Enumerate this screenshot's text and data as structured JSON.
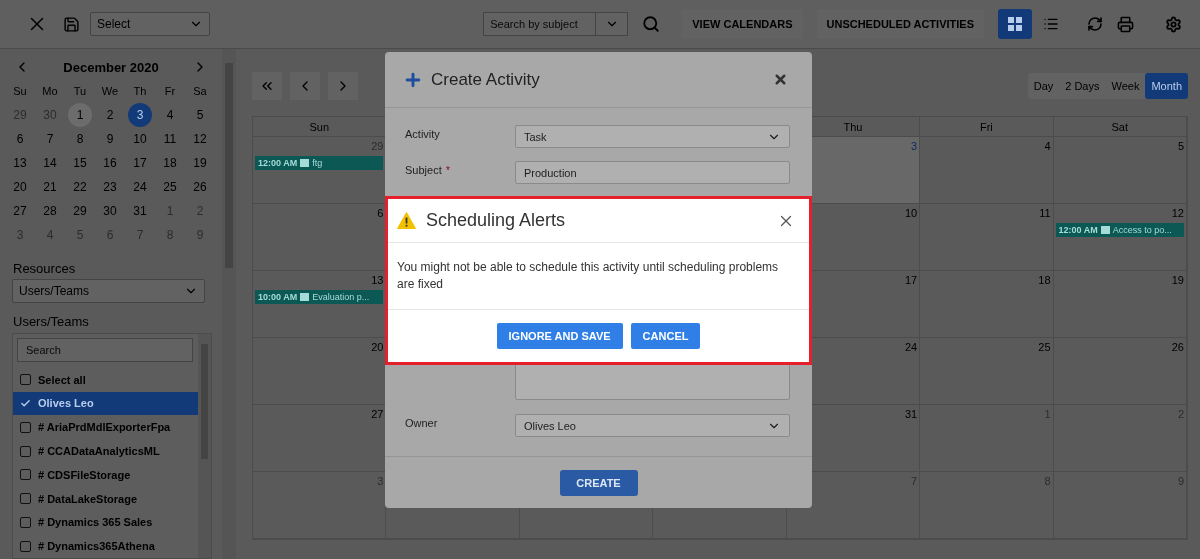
{
  "toolbar": {
    "view_select": {
      "value": "Select"
    },
    "search": {
      "placeholder": "Search by subject"
    },
    "buttons": [
      "VIEW CALENDARS",
      "UNSCHEDULED ACTIVITIES"
    ],
    "view_toggles": [
      {
        "kind": "grid",
        "selected": true
      },
      {
        "kind": "list",
        "selected": false
      }
    ]
  },
  "sidebar": {
    "mini_calendar": {
      "title": "December 2020",
      "weekdays": [
        "Su",
        "Mo",
        "Tu",
        "We",
        "Th",
        "Fr",
        "Sa"
      ],
      "weeks": [
        [
          {
            "label": "29",
            "kind": "muted"
          },
          {
            "label": "30",
            "kind": "muted"
          },
          {
            "label": "1",
            "kind": "hover"
          },
          {
            "label": "2",
            "kind": "normal"
          },
          {
            "label": "3",
            "kind": "today"
          },
          {
            "label": "4",
            "kind": "normal"
          },
          {
            "label": "5",
            "kind": "normal"
          }
        ],
        [
          {
            "label": "6",
            "kind": "normal"
          },
          {
            "label": "7",
            "kind": "normal"
          },
          {
            "label": "8",
            "kind": "normal"
          },
          {
            "label": "9",
            "kind": "normal"
          },
          {
            "label": "10",
            "kind": "normal"
          },
          {
            "label": "11",
            "kind": "normal"
          },
          {
            "label": "12",
            "kind": "normal"
          }
        ],
        [
          {
            "label": "13",
            "kind": "normal"
          },
          {
            "label": "14",
            "kind": "normal"
          },
          {
            "label": "15",
            "kind": "normal"
          },
          {
            "label": "16",
            "kind": "normal"
          },
          {
            "label": "17",
            "kind": "normal"
          },
          {
            "label": "18",
            "kind": "normal"
          },
          {
            "label": "19",
            "kind": "normal"
          }
        ],
        [
          {
            "label": "20",
            "kind": "normal"
          },
          {
            "label": "21",
            "kind": "normal"
          },
          {
            "label": "22",
            "kind": "normal"
          },
          {
            "label": "23",
            "kind": "normal"
          },
          {
            "label": "24",
            "kind": "normal"
          },
          {
            "label": "25",
            "kind": "normal"
          },
          {
            "label": "26",
            "kind": "normal"
          }
        ],
        [
          {
            "label": "27",
            "kind": "normal"
          },
          {
            "label": "28",
            "kind": "normal"
          },
          {
            "label": "29",
            "kind": "normal"
          },
          {
            "label": "30",
            "kind": "normal"
          },
          {
            "label": "31",
            "kind": "normal"
          },
          {
            "label": "1",
            "kind": "muted"
          },
          {
            "label": "2",
            "kind": "muted"
          }
        ],
        [
          {
            "label": "3",
            "kind": "muted"
          },
          {
            "label": "4",
            "kind": "muted"
          },
          {
            "label": "5",
            "kind": "muted"
          },
          {
            "label": "6",
            "kind": "muted"
          },
          {
            "label": "7",
            "kind": "muted"
          },
          {
            "label": "8",
            "kind": "muted"
          },
          {
            "label": "9",
            "kind": "muted"
          }
        ]
      ]
    },
    "resources": {
      "label": "Resources",
      "value": "Users/Teams"
    },
    "users_teams": {
      "label": "Users/Teams",
      "search": {
        "placeholder": "Search"
      },
      "items": [
        {
          "label": "Select all",
          "checked": false,
          "selected": false
        },
        {
          "label": "Olives Leo",
          "checked": true,
          "selected": true
        },
        {
          "label": "# AriaPrdMdlExporterFpa",
          "checked": false,
          "selected": false
        },
        {
          "label": "# CCADataAnalyticsML",
          "checked": false,
          "selected": false
        },
        {
          "label": "# CDSFileStorage",
          "checked": false,
          "selected": false
        },
        {
          "label": "# DataLakeStorage",
          "checked": false,
          "selected": false
        },
        {
          "label": "# Dynamics 365 Sales",
          "checked": false,
          "selected": false
        },
        {
          "label": "# Dynamics365Athena",
          "checked": false,
          "selected": false
        }
      ]
    }
  },
  "calendar": {
    "views": [
      {
        "label": "Day",
        "selected": false
      },
      {
        "label": "2 Days",
        "selected": false
      },
      {
        "label": "Week",
        "selected": false
      },
      {
        "label": "Month",
        "selected": true
      }
    ],
    "columns": [
      "Sun",
      "Thu",
      "Fri",
      "Sat"
    ],
    "weeks": [
      [
        {
          "date": "29",
          "kind": "muted",
          "events": [
            {
              "time": "12:00 AM",
              "title": "ftg"
            }
          ]
        },
        {
          "date": "3",
          "kind": "today"
        },
        {
          "date": "4",
          "kind": "normal"
        },
        {
          "date": "5",
          "kind": "normal"
        }
      ],
      [
        {
          "date": "6",
          "kind": "normal"
        },
        {
          "date": "10",
          "kind": "normal"
        },
        {
          "date": "11",
          "kind": "normal"
        },
        {
          "date": "12",
          "kind": "normal",
          "events": [
            {
              "time": "12:00 AM",
              "title": "Access to po..."
            }
          ]
        }
      ],
      [
        {
          "date": "13",
          "kind": "normal",
          "events": [
            {
              "time": "10:00 AM",
              "title": "Evaluation p..."
            }
          ]
        },
        {
          "date": "17",
          "kind": "normal"
        },
        {
          "date": "18",
          "kind": "normal"
        },
        {
          "date": "19",
          "kind": "normal"
        }
      ],
      [
        {
          "date": "20",
          "kind": "normal"
        },
        {
          "date": "24",
          "kind": "normal"
        },
        {
          "date": "25",
          "kind": "normal"
        },
        {
          "date": "26",
          "kind": "normal"
        }
      ],
      [
        {
          "date": "27",
          "kind": "normal"
        },
        {
          "date": "31",
          "kind": "normal"
        },
        {
          "date": "1",
          "kind": "muted"
        },
        {
          "date": "2",
          "kind": "muted"
        }
      ],
      [
        {
          "date": "3",
          "kind": "muted"
        },
        {
          "date": "7",
          "kind": "muted"
        },
        {
          "date": "8",
          "kind": "muted"
        },
        {
          "date": "9",
          "kind": "muted"
        }
      ]
    ]
  },
  "create_activity": {
    "title": "Create Activity",
    "fields": [
      {
        "kind": "select",
        "label": "Activity",
        "value": "Task"
      },
      {
        "kind": "text",
        "label": "Subject",
        "required_mark": "*",
        "value": "Production"
      },
      {
        "kind": "textarea"
      },
      {
        "kind": "select",
        "label": "Owner",
        "value": "Olives Leo"
      }
    ],
    "submit": "CREATE"
  },
  "alert": {
    "title": "Scheduling Alerts",
    "message": "You might not be able to schedule this activity until scheduling problems are fixed",
    "buttons": [
      "IGNORE AND SAVE",
      "CANCEL"
    ]
  }
}
